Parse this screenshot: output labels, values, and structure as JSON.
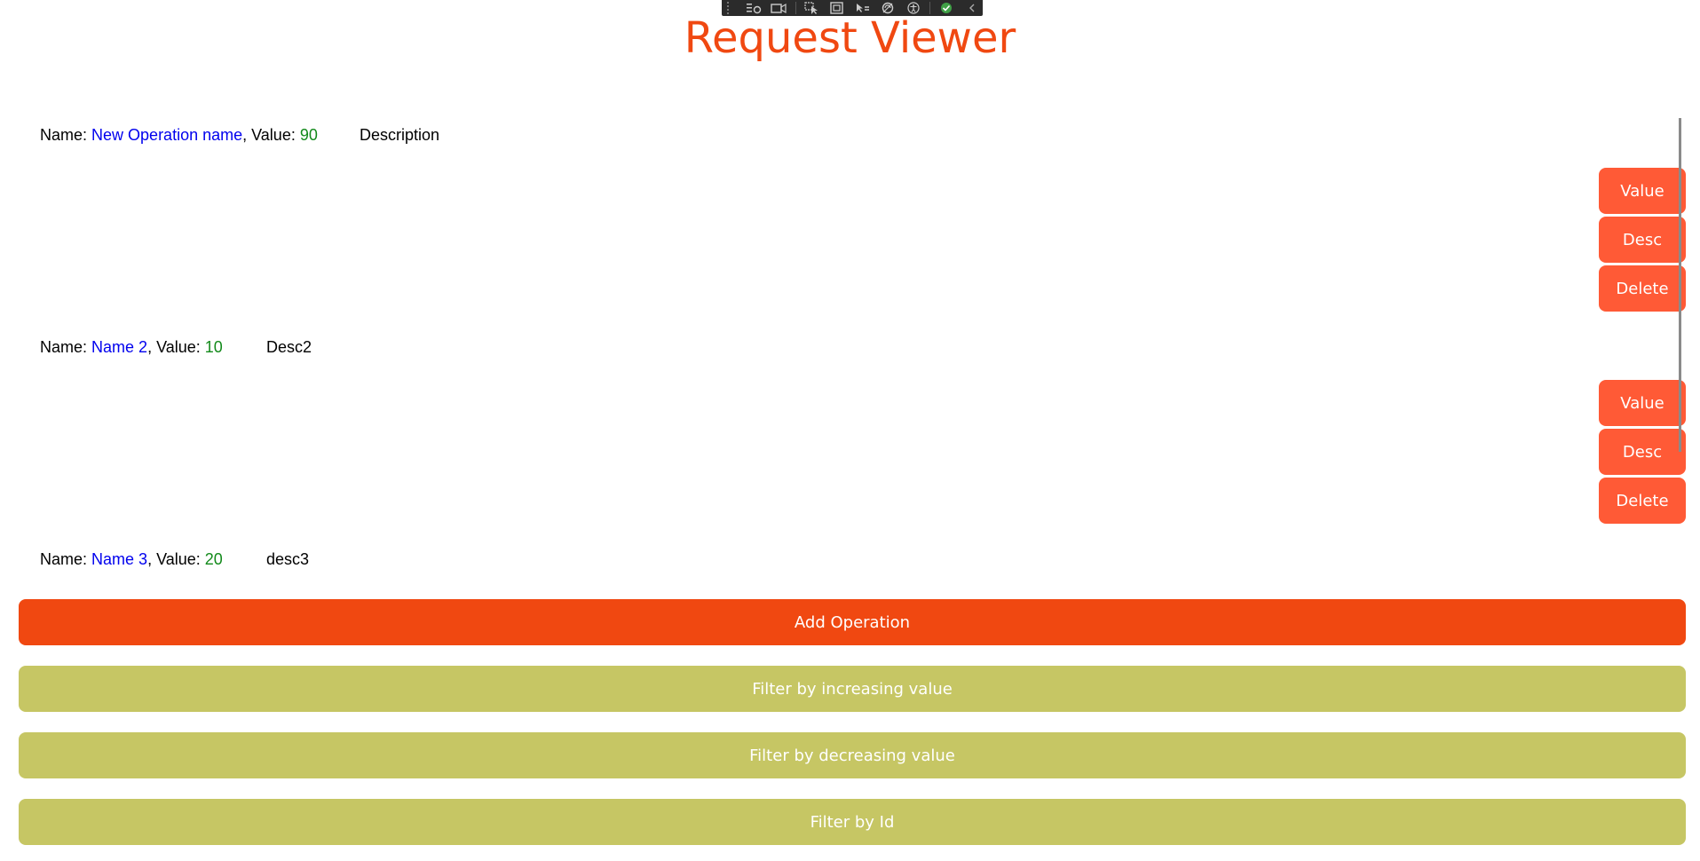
{
  "title": "Request Viewer",
  "toolbar": {
    "icons": [
      "live-tree-icon",
      "record-icon",
      "select-element-icon",
      "display-layout-icon",
      "track-focus-icon",
      "hot-reload-icon",
      "accessibility-icon",
      "status-check-icon",
      "collapse-chevron-icon"
    ]
  },
  "labels": {
    "name": "Name: ",
    "value": ", Value: "
  },
  "operations": [
    {
      "name": "New Operation name",
      "value": "90",
      "description": "Description"
    },
    {
      "name": "Name 2",
      "value": "10",
      "description": "Desc2"
    },
    {
      "name": "Name 3",
      "value": "20",
      "description": "desc3"
    }
  ],
  "side_buttons": {
    "value": "Value",
    "desc": "Desc",
    "delete": "Delete"
  },
  "actions": {
    "add": "Add Operation",
    "filter_increasing": "Filter by increasing value",
    "filter_decreasing": "Filter by decreasing value",
    "filter_id": "Filter by Id"
  },
  "colors": {
    "accent": "#f04811",
    "side_button": "#ff5a36",
    "filter_button": "#c6c664",
    "name_link": "#0000ee",
    "value_text": "#138a1b"
  }
}
